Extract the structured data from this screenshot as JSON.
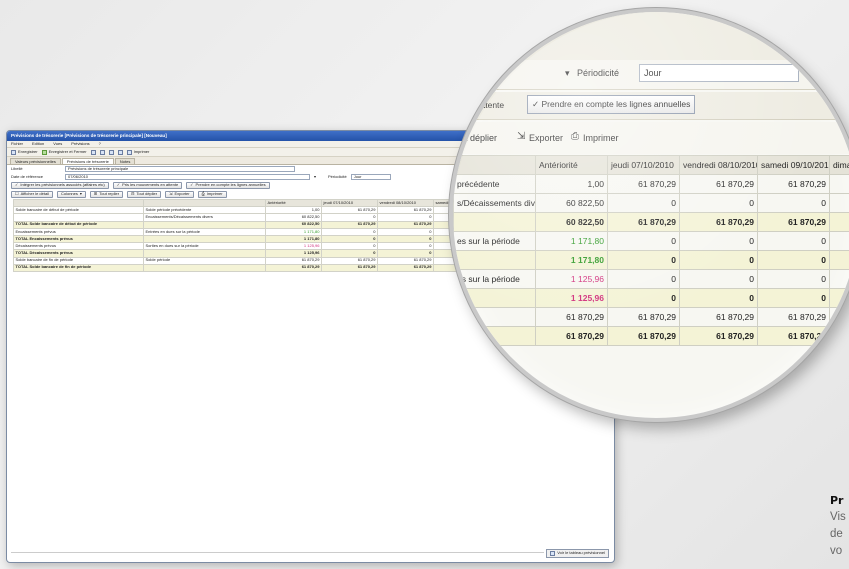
{
  "window": {
    "title": "Prévisions de trésorerie [Prévisions de trésorerie principale] [Nouveau]",
    "menu": [
      "Fichier",
      "Edition",
      "Vues",
      "Prévisions",
      "?"
    ],
    "toolbar": {
      "save": "Enregistrer",
      "save_close": "Enregistrer et Fermer",
      "print": "Imprimer"
    },
    "tabs": [
      "Valeurs prévisionnelles",
      "Prévisions de trésorerie",
      "Notes"
    ],
    "form": {
      "name_label": "Libellé",
      "name_value": "Prévisions de trésorerie principale",
      "date_label": "Date de référence",
      "date_value": "07/06/2010",
      "periodicity_label": "Périodicité",
      "periodicity_value": "Jour"
    },
    "checks": {
      "integrate": "Intégrer les prévisionnels associés (affaires etc)",
      "include_waiting": "Pris les mouvements en attente",
      "include_annual": "Prendre en compte les lignes annuelles"
    },
    "actions": {
      "show_detail": "Afficher le détail",
      "columns": "Colonnes",
      "expand_all": "Tout replier",
      "collapse_all": "Tout déplier",
      "export": "Exporter",
      "print": "Imprimer"
    },
    "grid": {
      "columns": [
        "",
        "",
        "Antériorité",
        "jeudi 07/10/2010",
        "vendredi 08/10/2010",
        "samedi 09/10/2010"
      ],
      "rows": [
        {
          "label": "Solde bancaire de début de période",
          "sub": "Solde période précédente",
          "values": [
            "1,00",
            "61 870,29",
            "61 870,29",
            "61 870,29"
          ],
          "style": ""
        },
        {
          "label": "",
          "sub": "Encaissements/Décaissements divers",
          "values": [
            "60 822,50",
            "0",
            "0",
            "0"
          ],
          "style": ""
        },
        {
          "label": "TOTAL Solde bancaire de début de période",
          "sub": "",
          "values": [
            "60 822,50",
            "61 870,29",
            "61 870,29",
            "61 870,29"
          ],
          "style": "total"
        },
        {
          "label": "Encaissements prévus",
          "sub": "Entrées en dues sur la période",
          "values": [
            "1 171,80",
            "0",
            "0",
            "0"
          ],
          "style": "green"
        },
        {
          "label": "TOTAL Encaissements prévus",
          "sub": "",
          "values": [
            "1 171,80",
            "0",
            "0",
            "0"
          ],
          "style": "total"
        },
        {
          "label": "Décaissements prévus",
          "sub": "Sorties en dues sur la période",
          "values": [
            "1 125,96",
            "0",
            "0",
            "0"
          ],
          "style": "pink"
        },
        {
          "label": "TOTAL Décaissements prévus",
          "sub": "",
          "values": [
            "1 125,96",
            "0",
            "0",
            "0"
          ],
          "style": "total"
        },
        {
          "label": "Solde bancaire de fin de période",
          "sub": "Solde période",
          "values": [
            "61 870,29",
            "61 870,29",
            "61 870,29",
            "61 870,29"
          ],
          "style": ""
        },
        {
          "label": "TOTAL Solde bancaire de fin de période",
          "sub": "",
          "values": [
            "61 870,29",
            "61 870,29",
            "61 870,29",
            "61 870,29"
          ],
          "style": "total"
        }
      ]
    },
    "status_button": "Voir le tableau prévisionnel"
  },
  "magnifier": {
    "periodicity_label": "Périodicité",
    "periodicity_value": "Jour",
    "waiting_text": "es en attente",
    "annual_text": "Prendre en compte les lignes annuelles",
    "collapse_text": "out déplier",
    "export": "Exporter",
    "print": "Imprimer",
    "headers": [
      "",
      "Antériorité",
      "jeudi 07/10/2010",
      "vendredi 08/10/2010",
      "samedi 09/10/2010",
      "dima"
    ],
    "rows": [
      {
        "label": "précédente",
        "values": [
          "1,00",
          "61 870,29",
          "61 870,29",
          "61 870,29",
          ""
        ],
        "style": ""
      },
      {
        "label": "s/Décaissements divers",
        "values": [
          "60 822,50",
          "0",
          "0",
          "0",
          ""
        ],
        "style": ""
      },
      {
        "label": "",
        "values": [
          "60 822,50",
          "61 870,29",
          "61 870,29",
          "61 870,29",
          ""
        ],
        "style": "total"
      },
      {
        "label": "es sur la période",
        "values": [
          "1 171,80",
          "0",
          "0",
          "0",
          ""
        ],
        "style": "green"
      },
      {
        "label": "",
        "values": [
          "1 171,80",
          "0",
          "0",
          "0",
          ""
        ],
        "style": "total-green"
      },
      {
        "label": "es sur la période",
        "values": [
          "1 125,96",
          "0",
          "0",
          "0",
          ""
        ],
        "style": "pink"
      },
      {
        "label": "",
        "values": [
          "1 125,96",
          "0",
          "0",
          "0",
          ""
        ],
        "style": "total-pink"
      },
      {
        "label": "",
        "values": [
          "61 870,29",
          "61 870,29",
          "61 870,29",
          "61 870,29",
          ""
        ],
        "style": ""
      },
      {
        "label": "",
        "values": [
          "61 870,29",
          "61 870,29",
          "61 870,29",
          "61 870,29",
          ""
        ],
        "style": "total"
      }
    ]
  },
  "caption": {
    "title": "Pr",
    "line1": "Vis",
    "line2": "de",
    "line3": "vo"
  },
  "colors": {
    "accent": "#2452a8",
    "green": "#2f9a28",
    "pink": "#d1317d",
    "total_bg": "#f4f3d6"
  }
}
